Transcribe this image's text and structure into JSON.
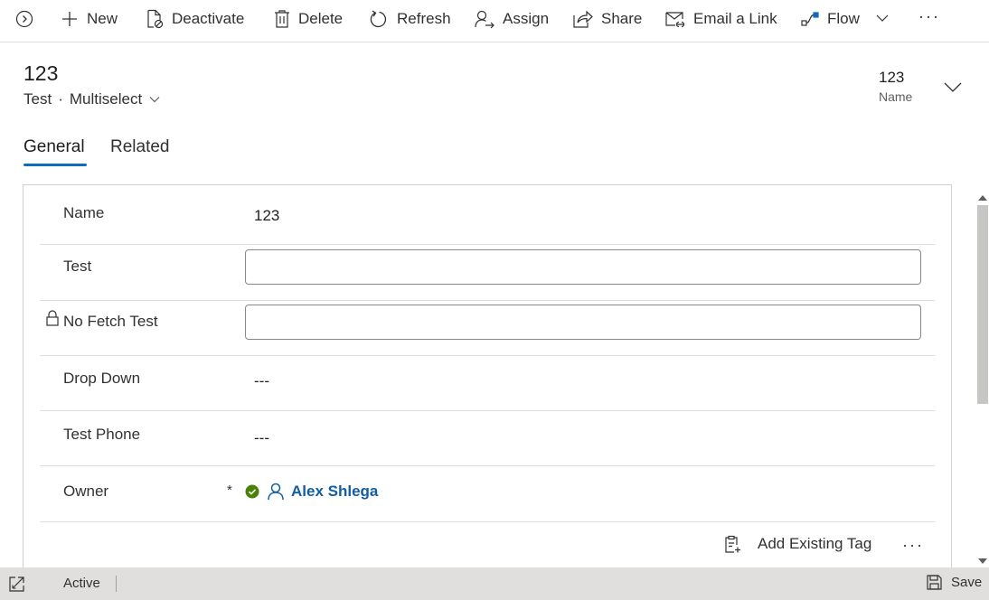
{
  "toolbar": {
    "new": "New",
    "deactivate": "Deactivate",
    "delete": "Delete",
    "refresh": "Refresh",
    "assign": "Assign",
    "share": "Share",
    "email_link": "Email a Link",
    "flow": "Flow",
    "more": "···"
  },
  "header": {
    "title": "123",
    "entity": "Test",
    "separator": "·",
    "form_name": "Multiselect",
    "field_value": "123",
    "field_label": "Name"
  },
  "tabs": [
    {
      "label": "General",
      "selected": true
    },
    {
      "label": "Related",
      "selected": false
    }
  ],
  "form": {
    "rows": [
      {
        "label": "Name",
        "value": "123"
      },
      {
        "label": "Test",
        "value": ""
      },
      {
        "label": "No Fetch Test",
        "value": ""
      },
      {
        "label": "Drop Down",
        "value": "---"
      },
      {
        "label": "Test Phone",
        "value": "---"
      },
      {
        "label": "Owner",
        "required": "*",
        "value": "Alex Shlega"
      }
    ]
  },
  "tag_bar": {
    "add_existing_tag": "Add Existing Tag",
    "more": "···"
  },
  "status_bar": {
    "status": "Active",
    "save": "Save"
  },
  "colors": {
    "accent": "#0f6cbd",
    "link": "#115ea3",
    "status_ok": "#498205",
    "status_bar_bg": "#e1dfdd"
  }
}
